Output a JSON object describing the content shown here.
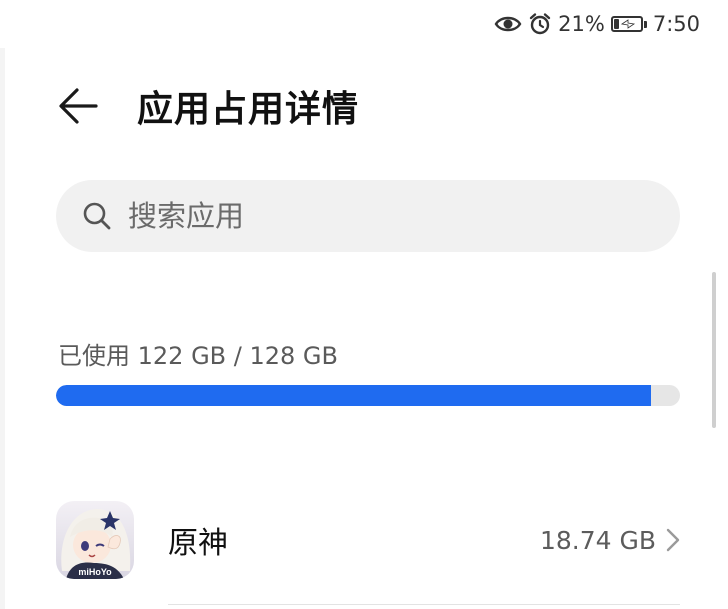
{
  "status_bar": {
    "battery_percent_label": "21%",
    "battery_level": 0.21,
    "time": "7:50",
    "icons": [
      "eye-icon",
      "alarm-icon",
      "battery-charging-icon"
    ]
  },
  "header": {
    "title": "应用占用详情",
    "back_icon": "arrow-left-icon"
  },
  "search": {
    "placeholder": "搜索应用",
    "value": "",
    "icon": "search-icon"
  },
  "storage": {
    "label": "已使用 122 GB / 128 GB",
    "used_fraction": 0.953,
    "bar_color": "#1f6bf0",
    "track_color": "#e6e6e6"
  },
  "apps": [
    {
      "name": "原神",
      "size": "18.74 GB",
      "icon": "genshin-app-icon",
      "icon_text": "miHoYo"
    }
  ]
}
